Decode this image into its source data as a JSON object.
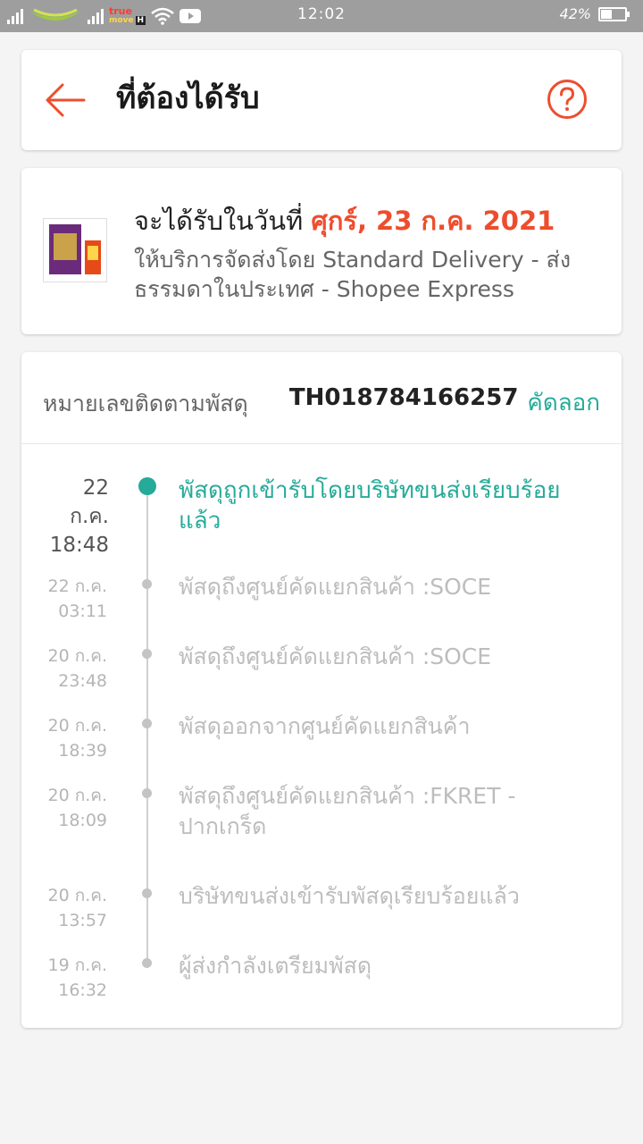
{
  "status_bar": {
    "carrier_top": "true",
    "carrier_bottom": "move",
    "network_badge": "H",
    "time": "12:02",
    "battery": "42%",
    "battery_level": 0.42
  },
  "header": {
    "title": "ที่ต้องได้รับ",
    "back_icon": "arrow-left-icon",
    "help_icon": "question-circle-icon"
  },
  "delivery": {
    "eta_prefix": "จะได้รับในวันที่",
    "eta_date": "ศุกร์, 23 ก.ค. 2021",
    "service": "ให้บริการจัดส่งโดย Standard Delivery - ส่งธรรมดาในประเทศ - Shopee Express"
  },
  "tracking": {
    "label": "หมายเลขติดตามพัสดุ",
    "number": "TH018784166257",
    "copy_label": "คัดลอก",
    "events": [
      {
        "date": "22 ก.ค.",
        "time": "18:48",
        "text": "พัสดุถูกเข้ารับโดยบริษัทขนส่งเรียบร้อยแล้ว"
      },
      {
        "date": "22 ก.ค.",
        "time": "03:11",
        "text": "พัสดุถึงศูนย์คัดแยกสินค้า :SOCE"
      },
      {
        "date": "20 ก.ค.",
        "time": "23:48",
        "text": "พัสดุถึงศูนย์คัดแยกสินค้า :SOCE"
      },
      {
        "date": "20 ก.ค.",
        "time": "18:39",
        "text": "พัสดุออกจากศูนย์คัดแยกสินค้า"
      },
      {
        "date": "20 ก.ค.",
        "time": "18:09",
        "text": "พัสดุถึงศูนย์คัดแยกสินค้า :FKRET - ปากเกร็ด"
      },
      {
        "date": "20 ก.ค.",
        "time": "13:57",
        "text": "บริษัทขนส่งเข้ารับพัสดุเรียบร้อยแล้ว"
      },
      {
        "date": "19 ก.ค.",
        "time": "16:32",
        "text": "ผู้ส่งกำลังเตรียมพัสดุ"
      }
    ]
  },
  "colors": {
    "accent_orange": "#ee4d2d",
    "accent_teal": "#26aa99"
  }
}
